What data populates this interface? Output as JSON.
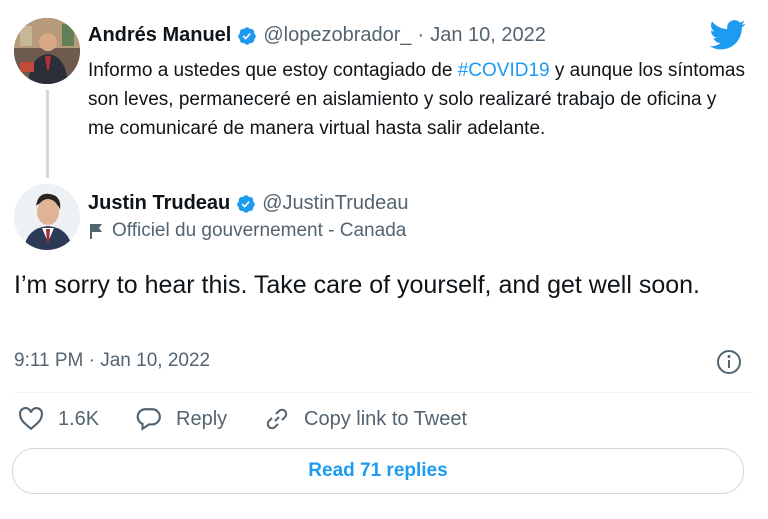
{
  "quoted_tweet": {
    "author_name": "Andrés Manuel",
    "handle": "@lopezobrador_",
    "separator": "·",
    "date": "Jan 10, 2022",
    "text_before": "Informo a ustedes que estoy contagiado de ",
    "hashtag": "#COVID19",
    "text_after": " y aunque los síntomas son leves, permaneceré en aislamiento y solo realizaré trabajo de oficina y me comunicaré de manera virtual hasta salir adelante."
  },
  "main_tweet": {
    "author_name": "Justin Trudeau",
    "handle": "@JustinTrudeau",
    "label": "Officiel du gouvernement - Canada",
    "text": "I’m sorry to hear this. Take care of yourself, and get well soon.",
    "time": "9:11 PM · Jan 10, 2022"
  },
  "actions": {
    "likes": "1.6K",
    "reply": "Reply",
    "copy_link": "Copy link to Tweet"
  },
  "read_replies": "Read 71 replies",
  "colors": {
    "twitter_blue": "#1d9bf0",
    "verified_blue": "#1d9bf0",
    "muted_text": "#536471"
  },
  "icons": [
    "twitter-bird-icon",
    "verified-icon",
    "flag-icon",
    "info-icon",
    "heart-icon",
    "reply-icon",
    "link-icon"
  ]
}
